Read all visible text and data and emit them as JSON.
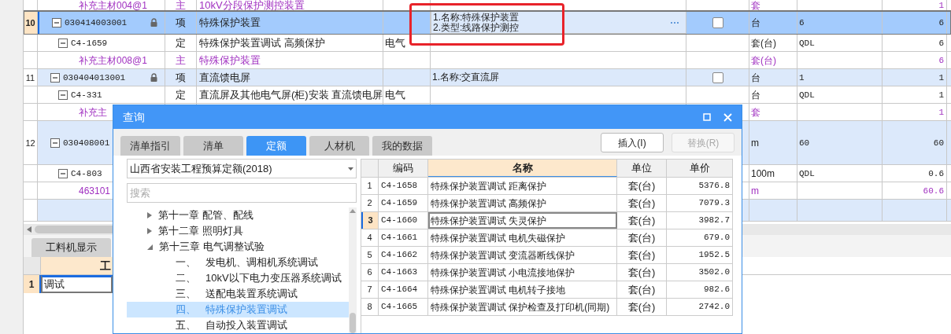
{
  "grid": {
    "rows": [
      {
        "kind": "material",
        "code": "补充主材004@1",
        "type": "主",
        "name": "10kV分段保护测控装置",
        "unit": "套",
        "quantity": "1"
      },
      {
        "kind": "item",
        "selected": true,
        "number": "10",
        "code": "030414003001",
        "locked": true,
        "type": "项",
        "name": "特殊保护装置",
        "features": [
          "1.名称:特殊保护装置",
          "2.类型:线路保护测控"
        ],
        "checked": false,
        "unit": "台",
        "expression": "6",
        "quantity": "6"
      },
      {
        "kind": "quota",
        "code": "C4-1659",
        "type": "定",
        "name": "特殊保护装置调试 高频保护",
        "specialty": "电气",
        "unit": "套(台)",
        "expression": "QDL",
        "quantity": "6"
      },
      {
        "kind": "material",
        "code": "补充主材008@1",
        "type": "主",
        "name": "特殊保护装置",
        "unit": "套(台)",
        "quantity": "6"
      },
      {
        "kind": "item",
        "selected": false,
        "number": "11",
        "code": "030404013001",
        "locked": true,
        "type": "项",
        "name": "直流馈电屏",
        "features": [
          "1.名称:交直流屏"
        ],
        "checked": false,
        "unit": "台",
        "expression": "1",
        "quantity": "1"
      },
      {
        "kind": "quota",
        "code": "C4-331",
        "type": "定",
        "name": "直流屏及其他电气屏(柜)安装 直流馈电屏",
        "specialty": "电气",
        "unit": "台",
        "expression": "QDL",
        "quantity": "1"
      },
      {
        "kind": "material",
        "code": "补充主",
        "unit": "套",
        "quantity": "1"
      },
      {
        "kind": "item",
        "selected": false,
        "number": "12",
        "code": "030408001",
        "unit": "m",
        "expression": "60",
        "quantity": "60"
      },
      {
        "kind": "quota",
        "code": "C4-803",
        "unit": "100m",
        "expression": "QDL",
        "quantity": "0.6"
      },
      {
        "kind": "material",
        "code": "463101",
        "unit": "m",
        "quantity": "60.6"
      },
      {
        "kind": "item",
        "selected": false
      }
    ]
  },
  "bottom_panel": {
    "tabs": [
      {
        "label": "工料机显示",
        "selected": true
      }
    ],
    "header": "工",
    "rows": [
      {
        "number": "1",
        "value": "调试"
      }
    ]
  },
  "dialog": {
    "title": "查询",
    "tabs": [
      {
        "label": "清单指引",
        "selected": false
      },
      {
        "label": "清单",
        "selected": false
      },
      {
        "label": "定额",
        "selected": true
      },
      {
        "label": "人材机",
        "selected": false
      },
      {
        "label": "我的数据",
        "selected": false
      }
    ],
    "buttons": [
      {
        "label": "插入(I)",
        "disabled": false
      },
      {
        "label": "替换(R)",
        "disabled": true
      }
    ],
    "library": "山西省安装工程预算定额(2018)",
    "search": {
      "placeholder": "搜索"
    },
    "tree": [
      {
        "label": "第十一章 配管、配线",
        "expanded": false,
        "selected": false
      },
      {
        "label": "第十二章 照明灯具",
        "expanded": false,
        "selected": false
      },
      {
        "label": "第十三章 电气调整试验",
        "expanded": true,
        "selected": false,
        "children": [
          {
            "index": "一、",
            "label": "发电机、调相机系统调试",
            "selected": false
          },
          {
            "index": "二、",
            "label": "10kV以下电力变压器系统调试",
            "selected": false
          },
          {
            "index": "三、",
            "label": "送配电装置系统调试",
            "selected": false
          },
          {
            "index": "四、",
            "label": "特殊保护装置调试",
            "selected": true
          },
          {
            "index": "五、",
            "label": "自动投入装置调试",
            "selected": false
          }
        ]
      }
    ],
    "table": {
      "columns": [
        {
          "label": "编码",
          "active": false
        },
        {
          "label": "名称",
          "active": true
        },
        {
          "label": "单位",
          "active": false
        },
        {
          "label": "单价",
          "active": false
        }
      ],
      "rows": [
        {
          "number": "1",
          "code": "C4-1658",
          "name": "特殊保护装置调试 距离保护",
          "unit": "套(台)",
          "price": "5376.8",
          "selected": false
        },
        {
          "number": "2",
          "code": "C4-1659",
          "name": "特殊保护装置调试 高频保护",
          "unit": "套(台)",
          "price": "7079.3",
          "selected": false
        },
        {
          "number": "3",
          "code": "C4-1660",
          "name": "特殊保护装置调试 失灵保护",
          "unit": "套(台)",
          "price": "3982.7",
          "selected": true
        },
        {
          "number": "4",
          "code": "C4-1661",
          "name": "特殊保护装置调试 电机失磁保护",
          "unit": "套(台)",
          "price": "679.0",
          "selected": false
        },
        {
          "number": "5",
          "code": "C4-1662",
          "name": "特殊保护装置调试 变流器断线保护",
          "unit": "套(台)",
          "price": "1952.5",
          "selected": false
        },
        {
          "number": "6",
          "code": "C4-1663",
          "name": "特殊保护装置调试 小电流接地保护",
          "unit": "套(台)",
          "price": "3502.0",
          "selected": false
        },
        {
          "number": "7",
          "code": "C4-1664",
          "name": "特殊保护装置调试 电机转子接地",
          "unit": "套(台)",
          "price": "982.6",
          "selected": false
        },
        {
          "number": "8",
          "code": "C4-1665",
          "name": "特殊保护装置调试 保护检查及打印机(同期)",
          "unit": "套(台)",
          "price": "2742.0",
          "selected": false
        }
      ]
    }
  }
}
